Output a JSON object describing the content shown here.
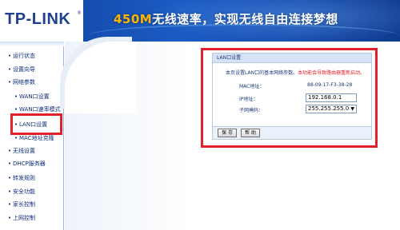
{
  "header": {
    "logo": "TP-LINK",
    "logo_reg": "®",
    "slogan_highlight": "450M",
    "slogan_rest": "无线速率，实现无线自由连接梦想"
  },
  "sidebar": {
    "items": [
      {
        "label": "运行状态",
        "level": "top"
      },
      {
        "label": "设置向导",
        "level": "top"
      },
      {
        "label": "网络参数",
        "level": "top"
      },
      {
        "label": "WAN口设置",
        "level": "sub"
      },
      {
        "label": "WAN口速率模式",
        "level": "sub"
      },
      {
        "label": "LAN口设置",
        "level": "sub",
        "active": true
      },
      {
        "label": "MAC地址克隆",
        "level": "sub"
      },
      {
        "label": "无线设置",
        "level": "top"
      },
      {
        "label": "DHCP服务器",
        "level": "top"
      },
      {
        "label": "转发规则",
        "level": "top"
      },
      {
        "label": "安全功能",
        "level": "top"
      },
      {
        "label": "家长控制",
        "level": "top"
      },
      {
        "label": "上网控制",
        "level": "top"
      }
    ],
    "bullet": "•"
  },
  "panel": {
    "title": "LAN口设置",
    "description": "本页设置LAN口的基本网络参数。",
    "warning": "本功能会导致路由器重新启动。",
    "mac_label": "MAC地址：",
    "mac_value": "88-09-17-F3-38-28",
    "ip_label": "IP地址：",
    "ip_value": "192.168.0.1",
    "mask_label": "子网掩码：",
    "mask_value": "255.255.255.0",
    "mask_arrow": "▼",
    "save_label": "保 存",
    "help_label": "帮 助"
  },
  "colors": {
    "header_blue": "#1b5cc4",
    "highlight_red": "#e2202a",
    "menu_text": "#0d2d7a",
    "slogan_accent": "#ffb400"
  }
}
